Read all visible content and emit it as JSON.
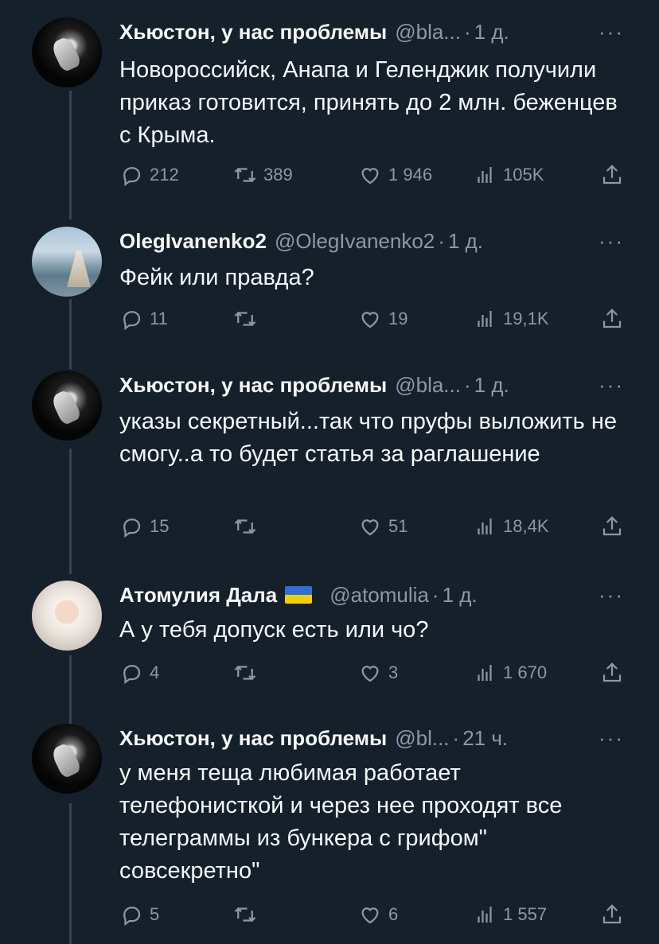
{
  "tweets": [
    {
      "name": "Хьюстон, у нас проблемы",
      "handle": "@bla...",
      "dot": "·",
      "time": "1 д.",
      "text": "Новороссийск, Анапа и Геленджик получили приказ готовится, принять до 2 млн. беженцев с Крыма.",
      "replies": "212",
      "retweets": "389",
      "likes": "1 946",
      "views": "105K",
      "avatar": "astronaut-in-space"
    },
    {
      "name": "OlegIvanenko2",
      "handle": "@OlegIvanenko2",
      "dot": "·",
      "time": "1 д.",
      "text": "Фейк или правда?",
      "replies": "11",
      "retweets": "",
      "likes": "19",
      "views": "19,1K",
      "avatar": "coastal-landscape"
    },
    {
      "name": "Хьюстон, у нас проблемы",
      "handle": "@bla...",
      "dot": "·",
      "time": "1 д.",
      "text": "указы секретный...так что пруфы выложить не смогу..а то будет статья за раглашение",
      "replies": "15",
      "retweets": "",
      "likes": "51",
      "views": "18,4K",
      "avatar": "astronaut-in-space"
    },
    {
      "name": "Атомулия Дала",
      "flag": "ukraine-flag",
      "handle": "@atomulia",
      "dot": "·",
      "time": "1 д.",
      "text": "А у тебя допуск есть или чо?",
      "replies": "4",
      "retweets": "",
      "likes": "3",
      "views": "1 670",
      "avatar": "person-portrait"
    },
    {
      "name": "Хьюстон, у нас проблемы",
      "handle": "@bl...",
      "dot": "·",
      "time": "21 ч.",
      "text": "у меня теща любимая работает телефонисткой и через нее проходят все телеграммы из бункера с грифом\" совсекретно\"",
      "replies": "5",
      "retweets": "",
      "likes": "6",
      "views": "1 557",
      "avatar": "astronaut-in-space"
    }
  ],
  "more_label": "···",
  "colors": {
    "background": "#15202b",
    "text": "#f7f9f9",
    "muted": "#8b98a5",
    "thread_line": "#38444d"
  },
  "icons": [
    "reply-icon",
    "retweet-icon",
    "like-icon",
    "views-icon",
    "share-icon",
    "more-icon"
  ]
}
